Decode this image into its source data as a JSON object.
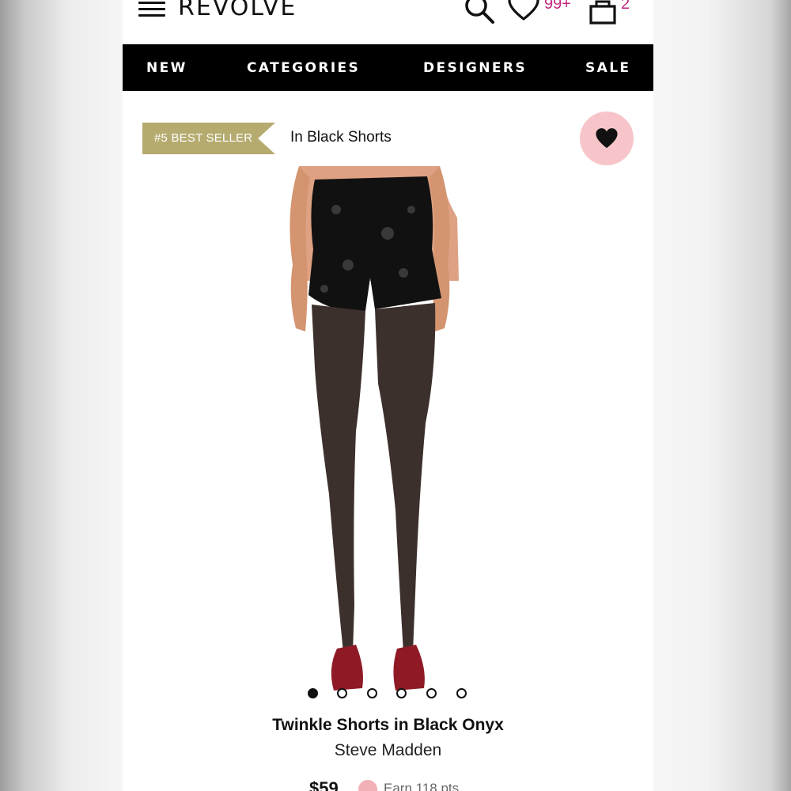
{
  "header": {
    "logo": "REVOLVE",
    "wishlist_count": "99+",
    "bag_count": "2",
    "icons": [
      "menu-icon",
      "search-icon",
      "heart-icon",
      "bag-icon"
    ]
  },
  "nav": {
    "items": [
      "NEW",
      "CATEGORIES",
      "DESIGNERS",
      "SALE"
    ]
  },
  "badge": {
    "label": "#5 BEST SELLER",
    "category": "In Black Shorts",
    "color": "#b5ab6f"
  },
  "favorite": {
    "icon": "heart-filled-icon",
    "color": "#f7c5c9"
  },
  "carousel": {
    "count": 6,
    "active_index": 0
  },
  "product": {
    "title": "Twinkle Shorts in Black Onyx",
    "designer": "Steve Madden",
    "price": "$59",
    "points": "Earn 118 pts"
  },
  "colors": {
    "accent": "#c2277f",
    "nav_bg": "#000000"
  }
}
